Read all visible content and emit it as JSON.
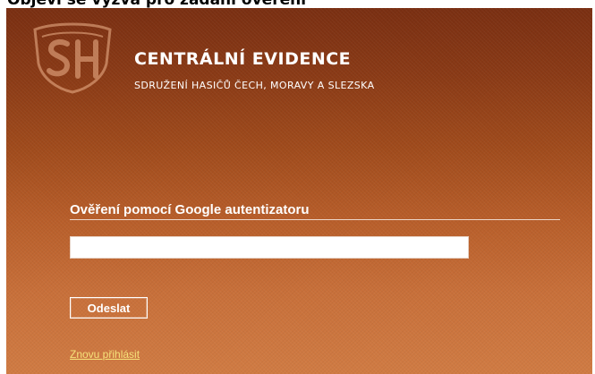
{
  "document": {
    "caption": "Objeví se výzva pro zadání ověření"
  },
  "header": {
    "logo_icon": "sh-cmsh-logo-icon",
    "logo_letters": "SH",
    "title": "CENTRÁLNÍ EVIDENCE",
    "subtitle": "SDRUŽENÍ HASIČŮ ČECH, MORAVY A SLEZSKA"
  },
  "form": {
    "heading": "Ověření pomocí Google autentizatoru",
    "code_value": "",
    "code_placeholder": "",
    "submit_label": "Odeslat",
    "relogin_link": "Znovu přihlásit"
  },
  "colors": {
    "panel_top": "#7a2f12",
    "panel_bottom": "#d07b43",
    "link": "#f6e27a",
    "text": "#ffffff"
  }
}
